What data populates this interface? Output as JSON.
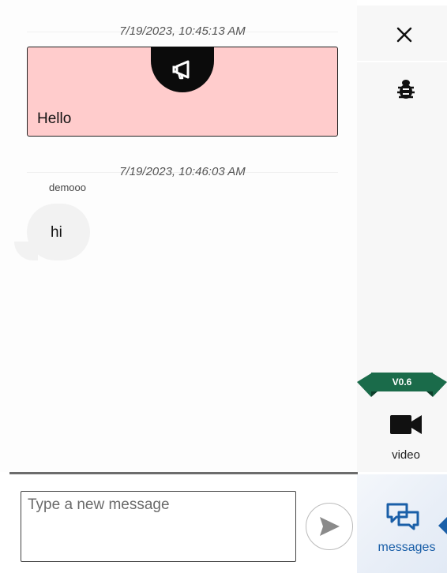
{
  "chat": {
    "messages": [
      {
        "type": "announcement",
        "timestamp": "7/19/2023, 10:45:13 AM",
        "text": "Hello",
        "background": "#ffcccc"
      },
      {
        "type": "message",
        "timestamp": "7/19/2023, 10:46:03 AM",
        "sender": "demooo",
        "text": "hi"
      }
    ]
  },
  "toolbar": {
    "close_icon": "close-icon",
    "bug_icon": "bug-icon",
    "version": "V0.6",
    "version_color": "#1a6b4a",
    "video_label": "video",
    "video_icon": "video-camera-icon"
  },
  "composer": {
    "placeholder": "Type a new message",
    "value": "",
    "send_icon": "send-icon"
  },
  "nav": {
    "messages_label": "messages",
    "messages_icon": "chat-bubbles-icon",
    "accent": "#1a5fa8"
  }
}
